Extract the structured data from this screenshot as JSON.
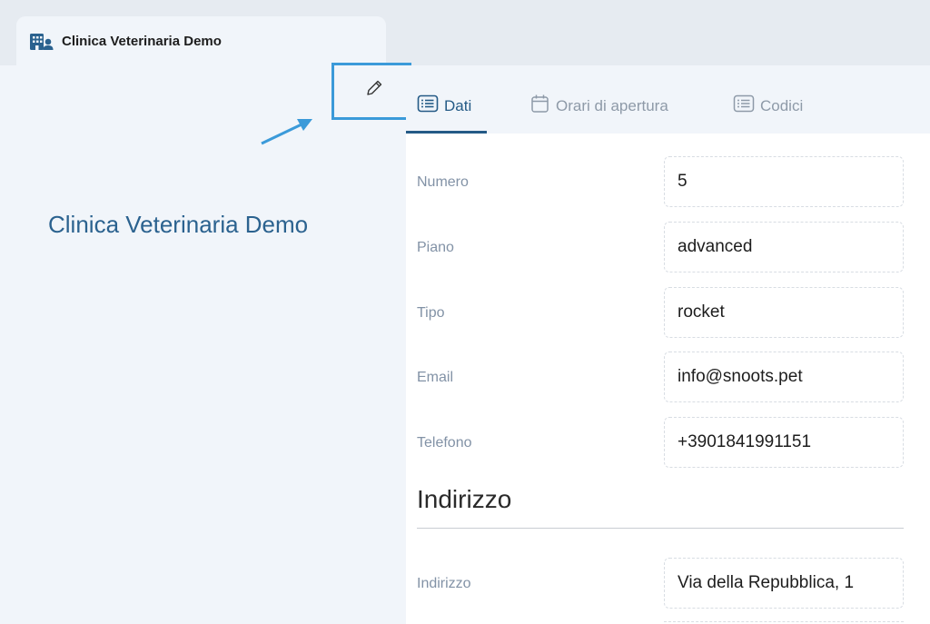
{
  "colors": {
    "accent": "#245a86",
    "annotation": "#3b9ad9",
    "label": "#8292a6"
  },
  "window_tab": {
    "icon": "building-user-icon",
    "title": "Clinica Veterinaria Demo"
  },
  "sidebar": {
    "name": "Clinica Veterinaria Demo",
    "edit_icon": "pencil-icon"
  },
  "tabs": [
    {
      "label": "Dati",
      "icon": "list-icon",
      "active": true
    },
    {
      "label": "Orari di apertura",
      "icon": "calendar-icon",
      "active": false
    },
    {
      "label": "Codici",
      "icon": "list-icon",
      "active": false
    }
  ],
  "fields": [
    {
      "label": "Numero",
      "value": "5"
    },
    {
      "label": "Piano",
      "value": "advanced"
    },
    {
      "label": "Tipo",
      "value": "rocket"
    },
    {
      "label": "Email",
      "value": "info@snoots.pet"
    },
    {
      "label": "Telefono",
      "value": "+3901841991151"
    }
  ],
  "address_section": {
    "title": "Indirizzo",
    "fields": [
      {
        "label": "Indirizzo",
        "value": "Via della Repubblica, 1"
      }
    ]
  }
}
